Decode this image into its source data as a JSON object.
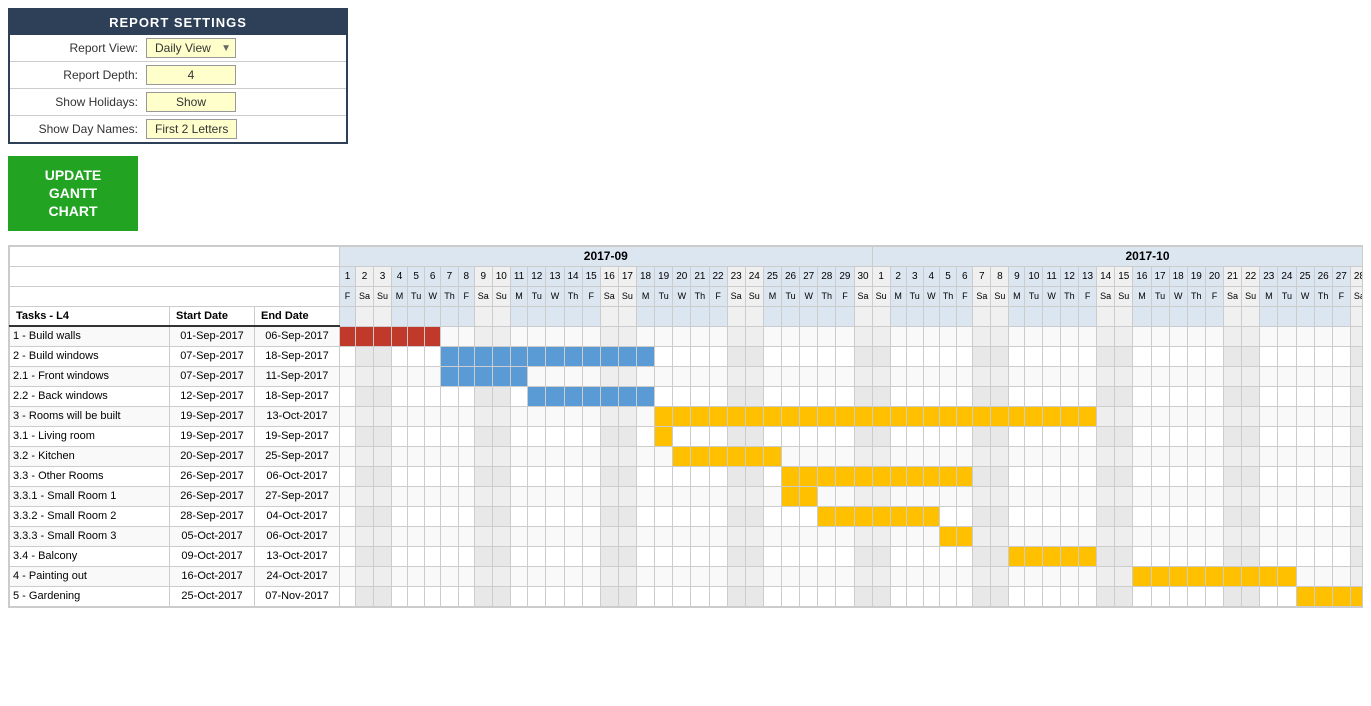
{
  "settings": {
    "title": "REPORT SETTINGS",
    "rows": [
      {
        "label": "Report View:",
        "value": "Daily View",
        "hasArrow": true
      },
      {
        "label": "Report Depth:",
        "value": "4",
        "hasArrow": false
      },
      {
        "label": "Show Holidays:",
        "value": "Show",
        "hasArrow": false
      },
      {
        "label": "Show Day Names:",
        "value": "First 2 Letters",
        "hasArrow": false
      }
    ]
  },
  "updateButton": "UPDATE\nGANTT CHART",
  "gantt": {
    "colHeaders": [
      "Tasks - L4",
      "Start Date",
      "End Date"
    ],
    "monthLabel": "2017-09",
    "tasks": [
      {
        "name": "1 - Build walls",
        "start": "01-Sep-2017",
        "end": "06-Sep-2017"
      },
      {
        "name": "2 - Build windows",
        "start": "07-Sep-2017",
        "end": "18-Sep-2017"
      },
      {
        "name": "2.1 - Front windows",
        "start": "07-Sep-2017",
        "end": "11-Sep-2017"
      },
      {
        "name": "2.2 - Back windows",
        "start": "12-Sep-2017",
        "end": "18-Sep-2017"
      },
      {
        "name": "3 - Rooms will be built",
        "start": "19-Sep-2017",
        "end": "13-Oct-2017"
      },
      {
        "name": "3.1 - Living room",
        "start": "19-Sep-2017",
        "end": "19-Sep-2017"
      },
      {
        "name": "3.2 - Kitchen",
        "start": "20-Sep-2017",
        "end": "25-Sep-2017"
      },
      {
        "name": "3.3 - Other Rooms",
        "start": "26-Sep-2017",
        "end": "06-Oct-2017"
      },
      {
        "name": "3.3.1 - Small Room 1",
        "start": "26-Sep-2017",
        "end": "27-Sep-2017"
      },
      {
        "name": "3.3.2 - Small Room 2",
        "start": "28-Sep-2017",
        "end": "04-Oct-2017"
      },
      {
        "name": "3.3.3 - Small Room 3",
        "start": "05-Oct-2017",
        "end": "06-Oct-2017"
      },
      {
        "name": "3.4 - Balcony",
        "start": "09-Oct-2017",
        "end": "13-Oct-2017"
      },
      {
        "name": "4 - Painting out",
        "start": "16-Oct-2017",
        "end": "24-Oct-2017"
      },
      {
        "name": "5 - Gardening",
        "start": "25-Oct-2017",
        "end": "07-Nov-2017"
      }
    ]
  }
}
